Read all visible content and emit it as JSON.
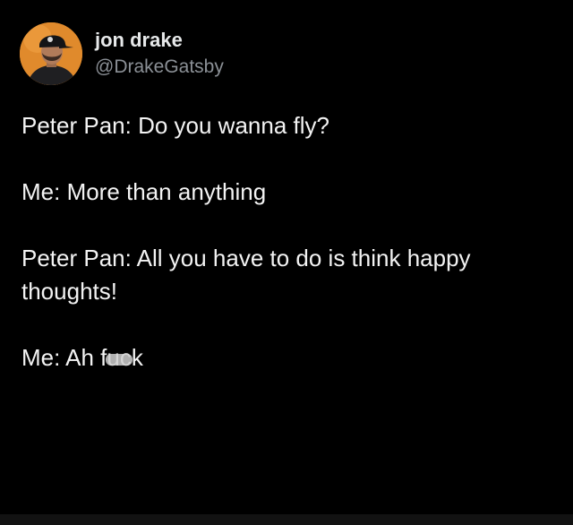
{
  "post": {
    "author": {
      "display_name": "jon drake",
      "handle": "@DrakeGatsby",
      "avatar_icon": "profile-avatar"
    },
    "paragraphs": [
      "Peter Pan: Do you wanna fly?",
      "Me: More than anything",
      "Peter Pan: All you have to do is think happy thoughts!",
      "Me: Ah fuck"
    ]
  },
  "colors": {
    "background": "#000000",
    "text": "#e7e9ea",
    "handle": "#8b9096",
    "avatar_bg": "#e08a2c"
  }
}
